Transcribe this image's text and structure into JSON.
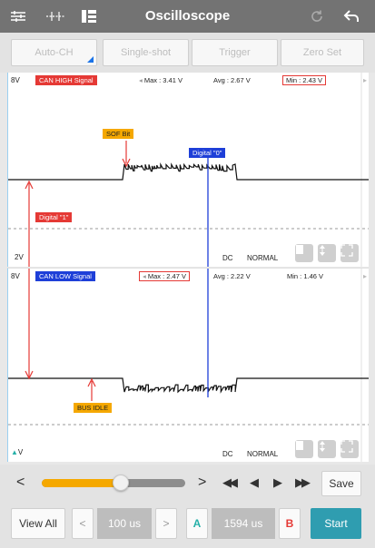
{
  "app": {
    "title": "Oscilloscope",
    "icons": [
      "sliders-icon",
      "cursor-lines-icon",
      "layout-icon",
      "refresh-icon",
      "back-arrow-icon"
    ]
  },
  "modes": [
    {
      "label": "Auto-CH"
    },
    {
      "label": "Single-shot"
    },
    {
      "label": "Trigger"
    },
    {
      "label": "Zero Set"
    }
  ],
  "channel_high": {
    "top_scale": "8V",
    "bottom_scale": "2V",
    "name": "CAN HIGH Signal",
    "max": "Max : 3.41 V",
    "avg": "Avg : 2.67 V",
    "min": "Min : 2.43 V",
    "coupling": "DC",
    "mode": "NORMAL",
    "annotations": {
      "sof": "SOF Bit",
      "digital0": "Digital \"0\"",
      "digital1": "Digital \"1\""
    },
    "color": "#e53935"
  },
  "channel_low": {
    "top_scale": "8V",
    "bottom_scale": "V",
    "name": "CAN LOW Signal",
    "max": "Max : 2.47 V",
    "avg": "Avg : 2.22 V",
    "min": "Min : 1.46 V",
    "coupling": "DC",
    "mode": "NORMAL",
    "annotations": {
      "bus_idle": "BUS IDLE"
    },
    "color": "#1e3fd8"
  },
  "playback": {
    "prev": "<",
    "next": ">",
    "rewind": "◀◀",
    "step_back": "◀",
    "play": "▶",
    "fast_forward": "▶▶",
    "save_label": "Save",
    "position": 0.55
  },
  "bottom": {
    "view_all": "View All",
    "prev": "<",
    "timebase": "100 us",
    "next": ">",
    "cursor_a": "A",
    "cursor_delta": "1594 us",
    "cursor_b": "B",
    "start": "Start"
  },
  "colors": {
    "accent_yellow": "#f5a800",
    "cursor_a": "#26b0a8",
    "cursor_b": "#e53935",
    "start": "#2f9db0"
  }
}
